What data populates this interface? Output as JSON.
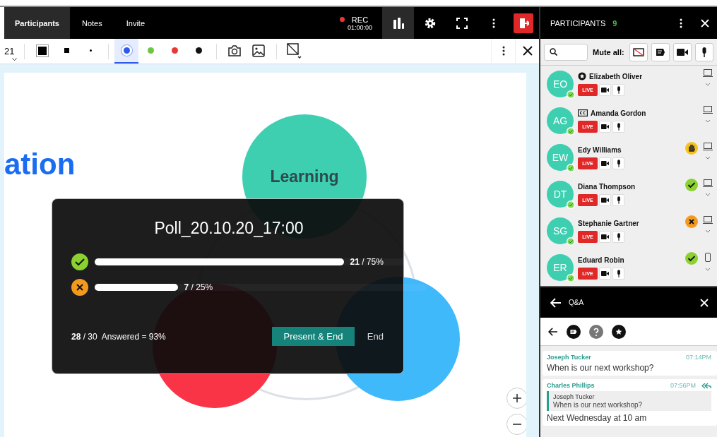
{
  "top_bar": {
    "tabs": [
      {
        "label": "Participants",
        "selected": true
      },
      {
        "label": "Notes",
        "selected": false
      },
      {
        "label": "Invite",
        "selected": false
      }
    ],
    "recording": {
      "label": "REC",
      "time": "01:00:00"
    },
    "tools": [
      {
        "kind": "poll",
        "selected": true
      },
      {
        "kind": "settings",
        "selected": false
      },
      {
        "kind": "fullscreen",
        "selected": false
      },
      {
        "kind": "more",
        "selected": false
      },
      {
        "kind": "exit",
        "selected": false
      }
    ]
  },
  "drawing_toolbar": {
    "size": "21",
    "brushes": [
      {
        "kind": "large",
        "selected": true
      },
      {
        "kind": "small",
        "selected": false
      },
      {
        "kind": "dot",
        "selected": false
      }
    ],
    "colors": [
      {
        "color": "#2f5bea",
        "selected": true
      },
      {
        "color": "#6cc644",
        "selected": false
      },
      {
        "color": "#e53935",
        "selected": false
      },
      {
        "color": "#111111",
        "selected": false
      }
    ]
  },
  "canvas": {
    "heading": "ation",
    "circles": [
      {
        "label": "Learning",
        "color": "#3ecfb0"
      },
      {
        "color": "#fa3447"
      },
      {
        "color": "#40b9fb"
      }
    ]
  },
  "poll": {
    "title": "Poll_20.10.20_17:00",
    "options": [
      {
        "kind": "yes",
        "level": 0.75,
        "result": "**21** / 75%"
      },
      {
        "kind": "no",
        "level": 0.25,
        "result": "**7** / 25%"
      }
    ],
    "summary": "**28** / 30  Answered = 93%",
    "buttons": [
      "Present & End",
      "End"
    ]
  },
  "participants": {
    "title": "PARTICIPANTS",
    "count": "9",
    "mute_all": "Mute all:",
    "people": [
      {
        "initials": "EO",
        "name": "Elizabeth Oliver",
        "badge": {
          "kind": "star"
        },
        "live": "LIVE",
        "device": {
          "kind": "laptop"
        }
      },
      {
        "initials": "AG",
        "name": "Amanda Gordon",
        "badge": {
          "kind": "cc"
        },
        "live": "LIVE",
        "device": {
          "kind": "laptop"
        }
      },
      {
        "initials": "EW",
        "name": "Edy Williams",
        "live": "LIVE",
        "status": {
          "kind": "hand"
        },
        "device": {
          "kind": "laptop"
        }
      },
      {
        "initials": "DT",
        "name": "Diana Thompson",
        "live": "LIVE",
        "status": {
          "kind": "yes"
        },
        "device": {
          "kind": "laptop"
        }
      },
      {
        "initials": "SG",
        "name": "Stephanie Gartner",
        "live": "LIVE",
        "status": {
          "kind": "no"
        },
        "device": {
          "kind": "laptop"
        }
      },
      {
        "initials": "ER",
        "name": "Eduard Robin",
        "live": "LIVE",
        "status": {
          "kind": "yes"
        },
        "device": {
          "kind": "phone"
        }
      }
    ]
  },
  "qa": {
    "title": "Q&A",
    "filters": [
      {
        "kind": "chat"
      },
      {
        "kind": "question"
      },
      {
        "kind": "starred"
      }
    ],
    "messages": [
      {
        "author": "Joseph Tucker",
        "time": "07:14PM",
        "text": "When is our next workshop?"
      },
      {
        "author": "Charles Phillips",
        "time": "07:56PM",
        "quote": {
          "author": "Joseph Tucker",
          "text": "When is our next workshop?"
        },
        "text": "Next Wednesday at 10 am"
      }
    ]
  }
}
